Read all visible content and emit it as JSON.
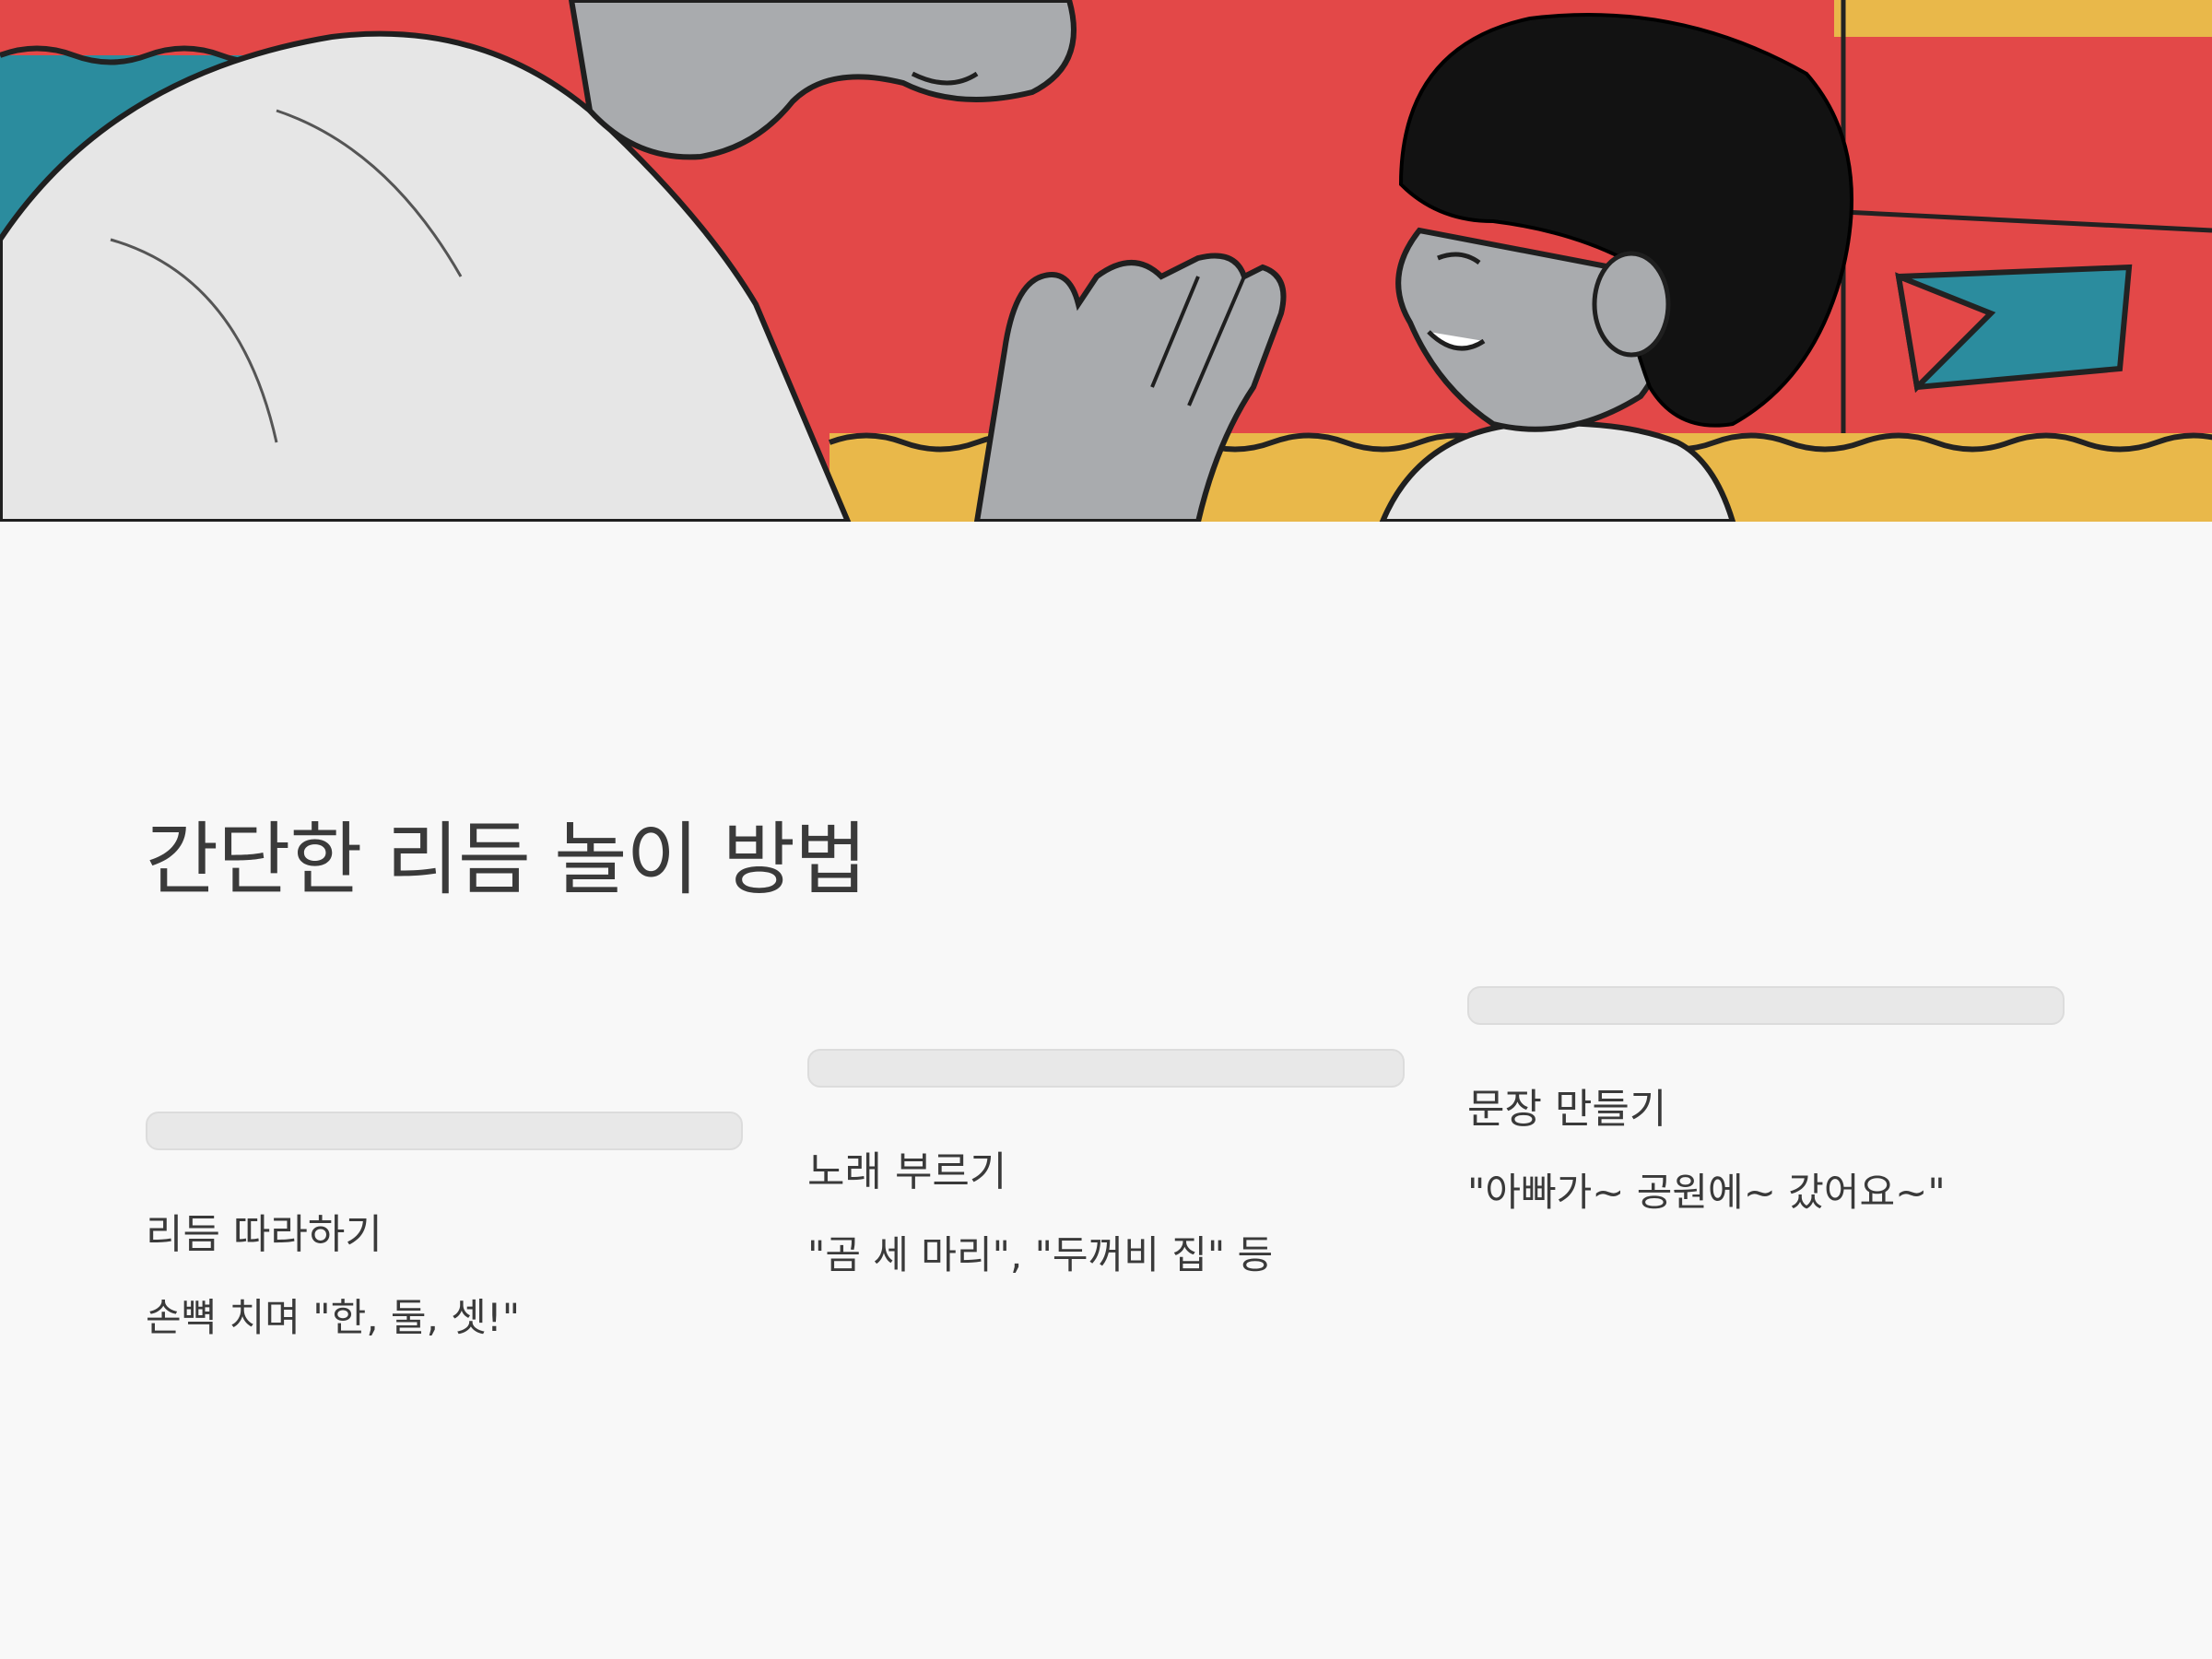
{
  "title": "간단한 리듬 놀이 방법",
  "cards": [
    {
      "title": "리듬 따라하기",
      "description": "손뼉 치며 \"한, 둘, 셋!\""
    },
    {
      "title": "노래 부르기",
      "description": "\"곰 세 마리\", \"두꺼비 집\" 등"
    },
    {
      "title": "문장 만들기",
      "description": "\"아빠가~ 공원에~ 갔어요~\""
    }
  ],
  "colors": {
    "page_background": "#f8f8f8",
    "text": "#3a3a3a",
    "card_bar": "#e8e8e8",
    "hero_red": "#e34848",
    "hero_teal": "#2b8c9e",
    "hero_yellow": "#e9b84a"
  }
}
